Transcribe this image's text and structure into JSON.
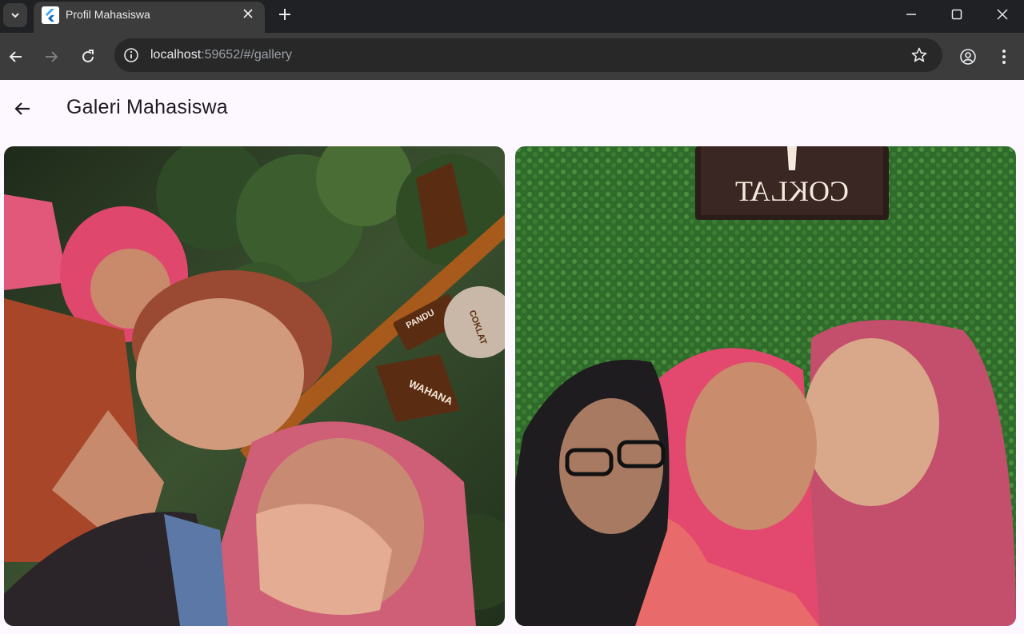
{
  "browser": {
    "tab_title": "Profil Mahasiswa",
    "url_host": "localhost",
    "url_rest": ":59652/#/gallery"
  },
  "app": {
    "title": "Galeri Mahasiswa"
  },
  "gallery": {
    "photos": [
      {
        "sign_text_1": "WAHANA",
        "sign_text_2": "PANDU",
        "sign_text_3": "COKLAT"
      },
      {
        "sign_text": "COKLAT"
      }
    ]
  },
  "icons": {
    "tab_search": "chevron-down-icon",
    "favicon": "flutter-logo-icon",
    "tab_close": "close-icon",
    "new_tab": "plus-icon",
    "minimize": "minimize-icon",
    "maximize": "maximize-icon",
    "close_window": "close-icon",
    "back": "arrow-left-icon",
    "forward": "arrow-right-icon",
    "reload": "reload-icon",
    "site_info": "info-icon",
    "bookmark": "star-icon",
    "profile": "account-icon",
    "menu": "more-vert-icon",
    "app_back": "arrow-back-icon"
  },
  "colors": {
    "chrome_dark": "#202124",
    "chrome_tab": "#3c3c3c",
    "app_background": "#fdf7ff"
  }
}
